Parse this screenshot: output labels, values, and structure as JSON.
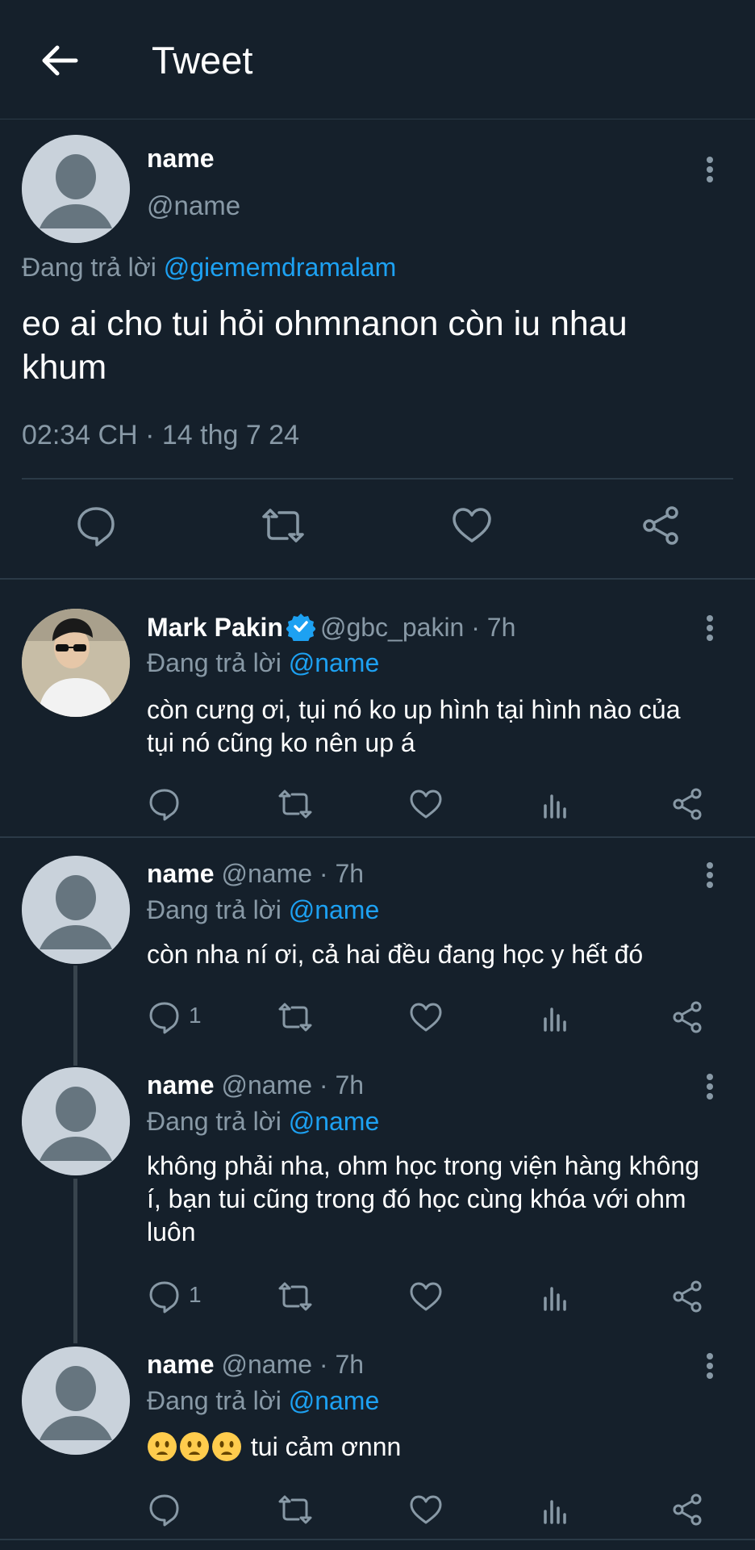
{
  "header": {
    "title": "Tweet"
  },
  "main_tweet": {
    "name": "name",
    "handle": "@name",
    "replying_prefix": "Đang trả lời",
    "replying_to": "@giememdramalam",
    "text": "eo ai cho tui hỏi ohmnanon còn iu nhau khum",
    "timestamp": "02:34 CH · 14 thg 7 24"
  },
  "replies": [
    {
      "name": "Mark Pakin",
      "verified": true,
      "handle": "@gbc_pakin",
      "time": "· 7h",
      "replying_prefix": "Đang trả lời",
      "replying_to": "@name",
      "text": "còn cưng ơi, tụi nó ko up hình tại hình nào của tụi nó cũng ko nên up á",
      "reply_count": ""
    },
    {
      "name": "name",
      "verified": false,
      "handle": "@name",
      "time": "· 7h",
      "replying_prefix": "Đang trả lời",
      "replying_to": "@name",
      "text": "còn nha ní ơi, cả hai đều đang học y hết đó",
      "reply_count": "1"
    },
    {
      "name": "name",
      "verified": false,
      "handle": "@name",
      "time": "· 7h",
      "replying_prefix": "Đang trả lời",
      "replying_to": "@name",
      "text": "không phải nha, ohm học trong viện hàng không í, bạn tui cũng trong đó học cùng khóa với ohm luôn",
      "reply_count": "1"
    },
    {
      "name": "name",
      "verified": false,
      "handle": "@name",
      "time": "· 7h",
      "replying_prefix": "Đang trả lời",
      "replying_to": "@name",
      "text": "tui cảm ơnnn",
      "emojis": [
        "frowning-face-icon",
        "frowning-face-icon",
        "frowning-face-icon"
      ],
      "reply_count": ""
    }
  ],
  "colors": {
    "background": "#15202b",
    "link": "#1da1f2",
    "muted": "#8899a6",
    "divider": "#2b3a47",
    "verified": "#1da1f2"
  },
  "icons": [
    "back-arrow-icon",
    "more-vertical-icon",
    "reply-icon",
    "retweet-icon",
    "like-icon",
    "share-icon",
    "analytics-icon",
    "verified-badge-icon"
  ]
}
